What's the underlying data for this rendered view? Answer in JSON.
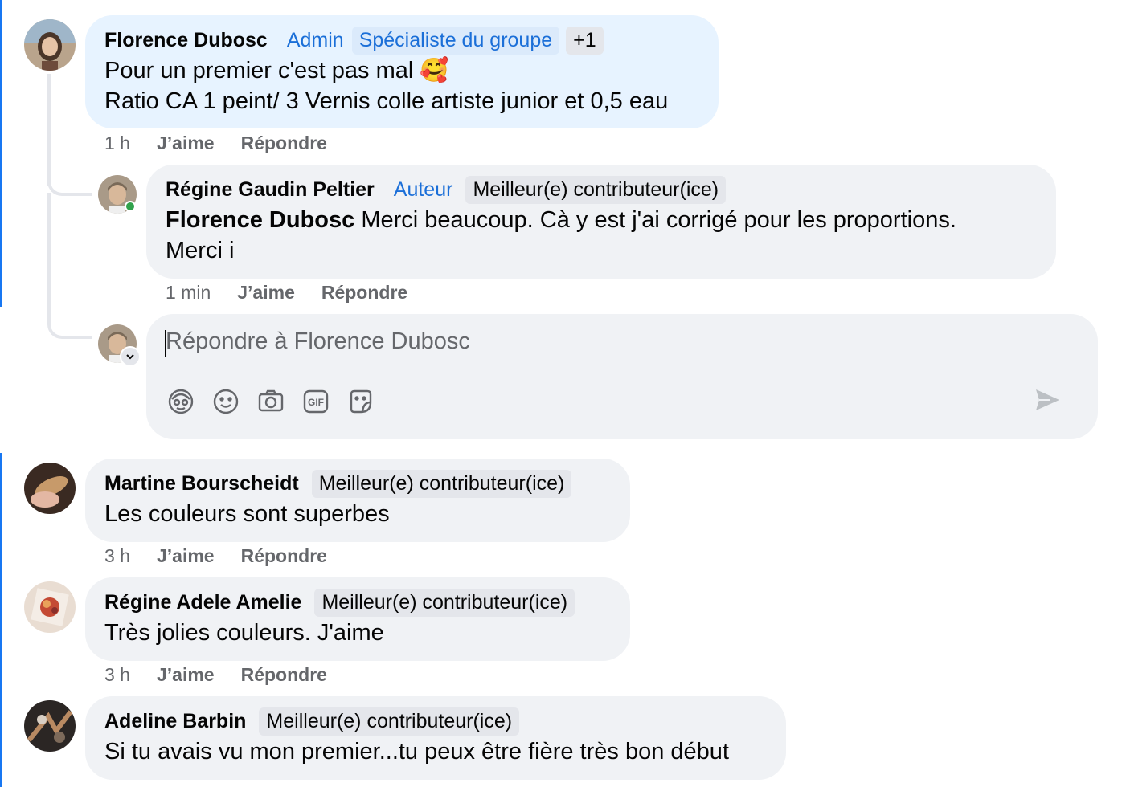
{
  "comments": [
    {
      "author": "Florence Dubosc",
      "badges": [
        "Admin",
        "Spécialiste du groupe"
      ],
      "extra_badges": "+1",
      "lines": [
        "Pour un premier c'est pas mal 🥰",
        "Ratio CA 1 peint/ 3 Vernis colle artiste junior et 0,5 eau"
      ],
      "time": "1 h",
      "like": "J’aime",
      "reply": "Répondre"
    },
    {
      "author": "Régine Gaudin Peltier",
      "badge_blue": "Auteur",
      "badge": "Meilleur(e) contributeur(ice)",
      "mention": "Florence Dubosc",
      "line1_rest": " Merci beaucoup. Cà y est j'ai corrigé pour les proportions.",
      "line2": "Merci i",
      "time": "1 min",
      "like": "J’aime",
      "reply": "Répondre"
    },
    {
      "author": "Martine Bourscheidt",
      "badge": "Meilleur(e) contributeur(ice)",
      "text": "Les couleurs sont superbes",
      "time": "3 h",
      "like": "J’aime",
      "reply": "Répondre"
    },
    {
      "author": "Régine Adele Amelie",
      "badge": "Meilleur(e) contributeur(ice)",
      "text": "Très jolies couleurs. J'aime",
      "time": "3 h",
      "like": "J’aime",
      "reply": "Répondre"
    },
    {
      "author": "Adeline Barbin",
      "badge": "Meilleur(e) contributeur(ice)",
      "text": "Si tu avais vu mon premier...tu peux être fière très bon début"
    }
  ],
  "reply_box": {
    "placeholder": "Répondre à Florence Dubosc",
    "tools": [
      "avatar-sticker-icon",
      "emoji-icon",
      "camera-icon",
      "gif-icon",
      "sticker-icon"
    ],
    "gif_label": "GIF",
    "send_icon": "send-icon"
  },
  "colors": {
    "accent_blue": "#1b6fd8",
    "highlight_bubble": "#e7f3ff",
    "bubble": "#f0f2f5",
    "meta_gray": "#65676b",
    "online_green": "#31a24c"
  }
}
